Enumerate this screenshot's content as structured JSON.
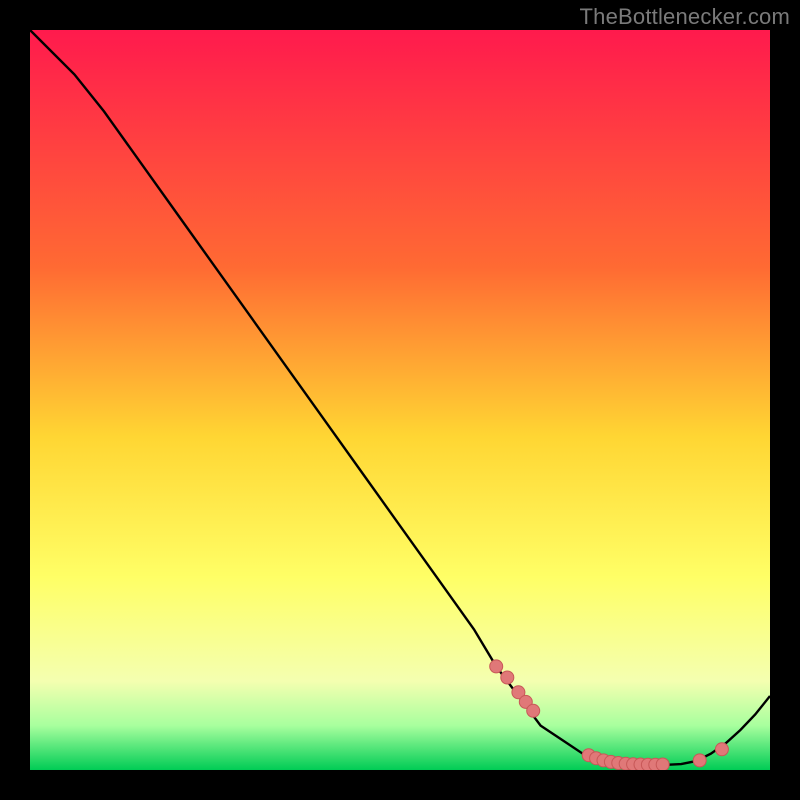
{
  "watermark": "TheBottlenecker.com",
  "colors": {
    "bg": "#000000",
    "curve": "#000000",
    "marker_fill": "#e07878",
    "marker_stroke": "#c85858",
    "grad_top": "#ff1a4d",
    "grad_mid1": "#ff6a33",
    "grad_mid2": "#ffd633",
    "grad_mid3": "#ffff66",
    "grad_mid4": "#f4ffb0",
    "grad_band": "#a8ff9e",
    "grad_bottom": "#00cc55"
  },
  "chart_data": {
    "type": "line",
    "title": "",
    "xlabel": "",
    "ylabel": "",
    "xlim": [
      0,
      100
    ],
    "ylim": [
      0,
      100
    ],
    "x": [
      0,
      6,
      10,
      15,
      20,
      25,
      30,
      35,
      40,
      45,
      50,
      55,
      60,
      63,
      66,
      69,
      72,
      75,
      78,
      80,
      82,
      84,
      86,
      88,
      90,
      92,
      94,
      96,
      98,
      100
    ],
    "y": [
      100,
      94,
      89,
      82,
      75,
      68,
      61,
      54,
      47,
      40,
      33,
      26,
      19,
      14,
      10,
      6,
      4,
      2,
      1.2,
      1.0,
      0.8,
      0.7,
      0.7,
      0.8,
      1.2,
      2.2,
      3.6,
      5.4,
      7.5,
      10
    ],
    "markers": {
      "x": [
        63,
        64.5,
        66,
        67,
        68,
        75.5,
        76.5,
        77.5,
        78.5,
        79.5,
        80.5,
        81.5,
        82.5,
        83.5,
        84.5,
        85.5,
        90.5,
        93.5
      ],
      "y": [
        14,
        12.5,
        10.5,
        9.2,
        8.0,
        2.0,
        1.6,
        1.3,
        1.1,
        0.95,
        0.85,
        0.78,
        0.74,
        0.72,
        0.72,
        0.75,
        1.3,
        2.8
      ]
    }
  }
}
